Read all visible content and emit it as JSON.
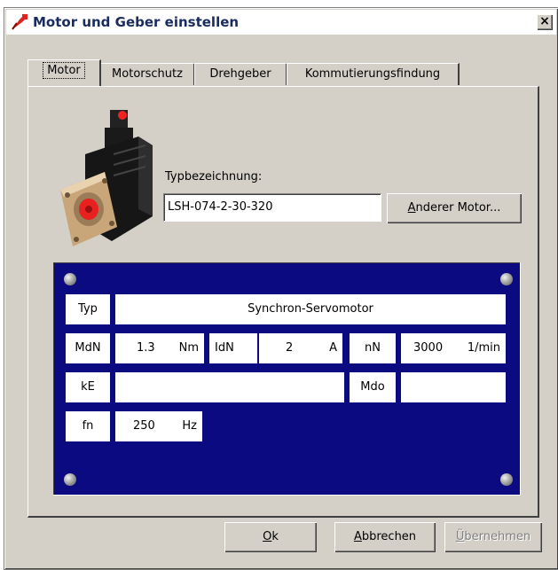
{
  "window": {
    "title": "Motor und Geber einstellen",
    "close_glyph": "×"
  },
  "tabs": [
    {
      "label": "Motor",
      "active": true
    },
    {
      "label": "Motorschutz",
      "active": false
    },
    {
      "label": "Drehgeber",
      "active": false
    },
    {
      "label": "Kommutierungsfindung",
      "active": false
    }
  ],
  "motor": {
    "type_label": "Typbezeichnung:",
    "type_value": "LSH-074-2-30-320",
    "other_motor_button_prefix": "A",
    "other_motor_button_rest": "nderer Motor..."
  },
  "nameplate": {
    "typ": {
      "label": "Typ",
      "value": "Synchron-Servomotor"
    },
    "mdn": {
      "label": "MdN",
      "value": "1.3",
      "unit": "Nm"
    },
    "idn": {
      "label": "IdN",
      "value": "2",
      "unit": "A"
    },
    "nn": {
      "label": "nN",
      "value": "3000",
      "unit": "1/min"
    },
    "ke": {
      "label": "kE",
      "value": ""
    },
    "mdo": {
      "label": "Mdo",
      "value": ""
    },
    "fn": {
      "label": "fn",
      "value": "250",
      "unit": "Hz"
    }
  },
  "buttons": {
    "ok_prefix": "O",
    "ok_rest": "k",
    "cancel_prefix": "A",
    "cancel_rest": "bbrechen",
    "apply_prefix": "Ü",
    "apply_rest": "bernehmen"
  },
  "colors": {
    "nameplate_bg": "#0c0a80",
    "dialog_bg": "#d4d0c8"
  }
}
